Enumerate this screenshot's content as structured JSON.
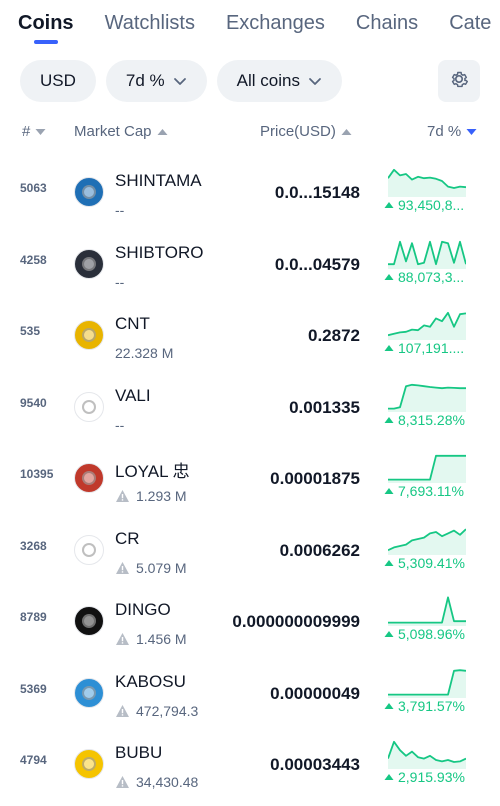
{
  "tabs": [
    {
      "label": "Coins",
      "active": true
    },
    {
      "label": "Watchlists",
      "active": false
    },
    {
      "label": "Exchanges",
      "active": false
    },
    {
      "label": "Chains",
      "active": false
    },
    {
      "label": "Cate",
      "active": false
    }
  ],
  "filters": {
    "currency": "USD",
    "period": "7d %",
    "scope": "All coins"
  },
  "table_header": {
    "rank": "#",
    "market_cap": "Market Cap",
    "price": "Price(USD)",
    "change": "7d %"
  },
  "colors": {
    "accent": "#3861fb",
    "positive": "#16c784",
    "text": "#111827",
    "muted": "#58667e",
    "pill_bg": "#eff2f5"
  },
  "coins": [
    {
      "rank": "5063",
      "name": "SHINTAMA",
      "market_cap": "--",
      "warning": false,
      "price": "0.0...15148",
      "change": "93,450,8...",
      "logo_bg": "#1f6fb5",
      "spark": [
        0.6,
        0.9,
        0.7,
        0.75,
        0.55,
        0.65,
        0.6,
        0.62,
        0.58,
        0.5,
        0.3,
        0.25,
        0.3,
        0.28
      ]
    },
    {
      "rank": "4258",
      "name": "SHIBTORO",
      "market_cap": "--",
      "warning": false,
      "price": "0.0...04579",
      "change": "88,073,3...",
      "logo_bg": "#2a2f3a",
      "spark": [
        0.1,
        0.1,
        0.9,
        0.2,
        0.85,
        0.1,
        0.15,
        0.9,
        0.1,
        0.9,
        0.85,
        0.15,
        0.9,
        0.1
      ]
    },
    {
      "rank": "535",
      "name": "CNT",
      "market_cap": "22.328 M",
      "warning": false,
      "price": "0.2872",
      "change": "107,191....",
      "logo_bg": "#e8b400",
      "spark": [
        0.1,
        0.15,
        0.2,
        0.22,
        0.3,
        0.28,
        0.45,
        0.4,
        0.7,
        0.6,
        0.9,
        0.4,
        0.85,
        0.88
      ]
    },
    {
      "rank": "9540",
      "name": "VALI",
      "market_cap": "--",
      "warning": false,
      "price": "0.001335",
      "change": "8,315.28%",
      "logo_bg": "#ffffff",
      "spark": [
        0.05,
        0.05,
        0.1,
        0.85,
        0.9,
        0.88,
        0.85,
        0.82,
        0.8,
        0.78,
        0.8,
        0.79,
        0.78,
        0.78
      ]
    },
    {
      "rank": "10395",
      "name": "LOYAL 忠",
      "market_cap": "1.293 M",
      "warning": true,
      "price": "0.00001875",
      "change": "7,693.11%",
      "logo_bg": "#c0392b",
      "spark": [
        0.05,
        0.05,
        0.05,
        0.05,
        0.05,
        0.05,
        0.05,
        0.05,
        0.9,
        0.9,
        0.9,
        0.9,
        0.9,
        0.9
      ]
    },
    {
      "rank": "3268",
      "name": "CR",
      "market_cap": "5.079 M",
      "warning": true,
      "price": "0.0006262",
      "change": "5,309.41%",
      "logo_bg": "#ffffff",
      "spark": [
        0.1,
        0.2,
        0.25,
        0.3,
        0.45,
        0.5,
        0.55,
        0.7,
        0.75,
        0.6,
        0.7,
        0.8,
        0.65,
        0.85
      ]
    },
    {
      "rank": "8789",
      "name": "DINGO",
      "market_cap": "1.456 M",
      "warning": true,
      "price": "0.000000009999",
      "change": "5,098.96%",
      "logo_bg": "#111111",
      "spark": [
        0.05,
        0.05,
        0.05,
        0.05,
        0.05,
        0.05,
        0.05,
        0.05,
        0.05,
        0.05,
        0.95,
        0.1,
        0.1,
        0.1
      ]
    },
    {
      "rank": "5369",
      "name": "KABOSU",
      "market_cap": "472,794.3",
      "warning": true,
      "price": "0.00000049",
      "change": "3,791.57%",
      "logo_bg": "#2d8fd5",
      "spark": [
        0.05,
        0.05,
        0.05,
        0.05,
        0.05,
        0.05,
        0.05,
        0.05,
        0.05,
        0.05,
        0.05,
        0.9,
        0.92,
        0.9
      ]
    },
    {
      "rank": "4794",
      "name": "BUBU",
      "market_cap": "34,430.48",
      "warning": true,
      "price": "0.00003443",
      "change": "2,915.93%",
      "logo_bg": "#f5c400",
      "spark": [
        0.3,
        0.9,
        0.6,
        0.4,
        0.55,
        0.35,
        0.3,
        0.4,
        0.25,
        0.2,
        0.25,
        0.18,
        0.2,
        0.3
      ]
    }
  ]
}
